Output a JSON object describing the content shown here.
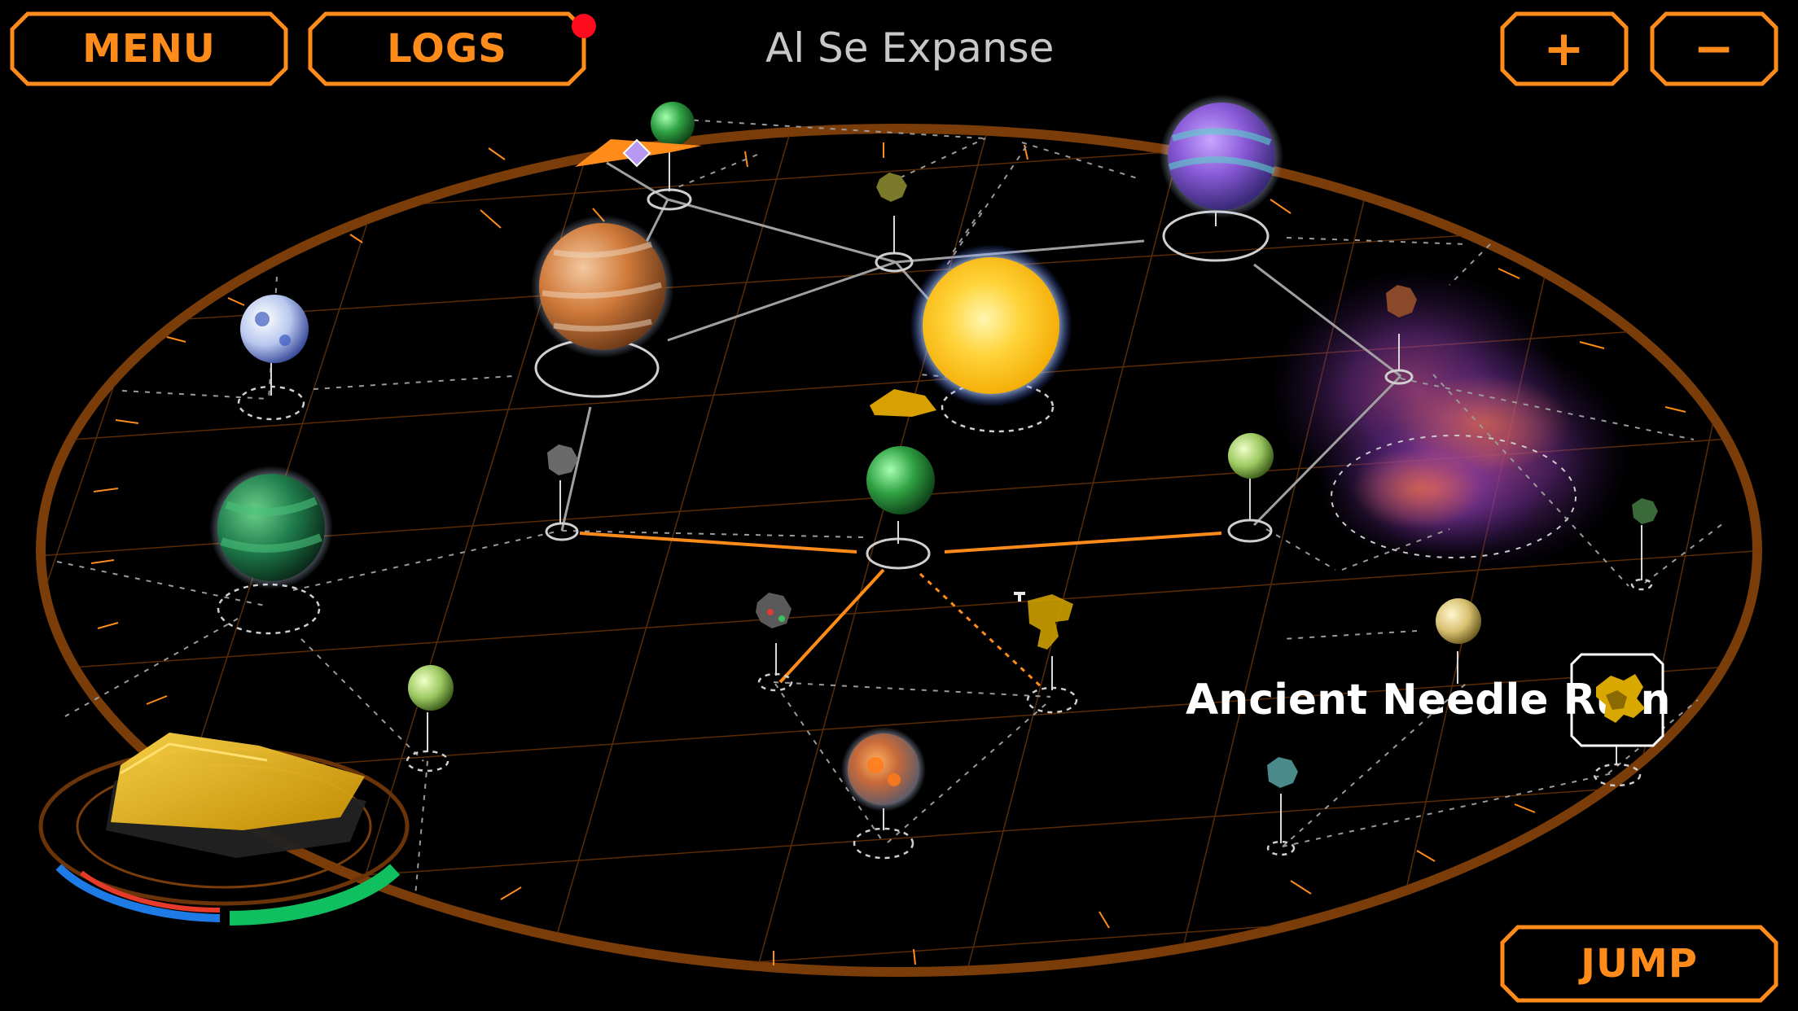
{
  "hud": {
    "menu_label": "MENU",
    "logs_label": "LOGS",
    "logs_has_notification": true,
    "zoom_in_label": "+",
    "zoom_out_label": "−",
    "jump_label": "JUMP"
  },
  "sector": {
    "title": "Al Se Expanse"
  },
  "selected_target": {
    "name": "Ancient Needle Ruin",
    "icon": "ancient-ruin-icon"
  },
  "colors": {
    "accent_orange": "#ff8c1a",
    "map_rim": "#7a3d0a",
    "route_active": "#ff8c1a",
    "notification": "#ff0a1e",
    "shield_blue": "#1e7be6",
    "hull_red": "#e63a2a",
    "energy_green": "#10c060",
    "ship_yellow": "#e8b000"
  },
  "player_ship": {
    "shield_level": 0.33,
    "hull_level": 0.33,
    "energy_level": 0.33
  }
}
